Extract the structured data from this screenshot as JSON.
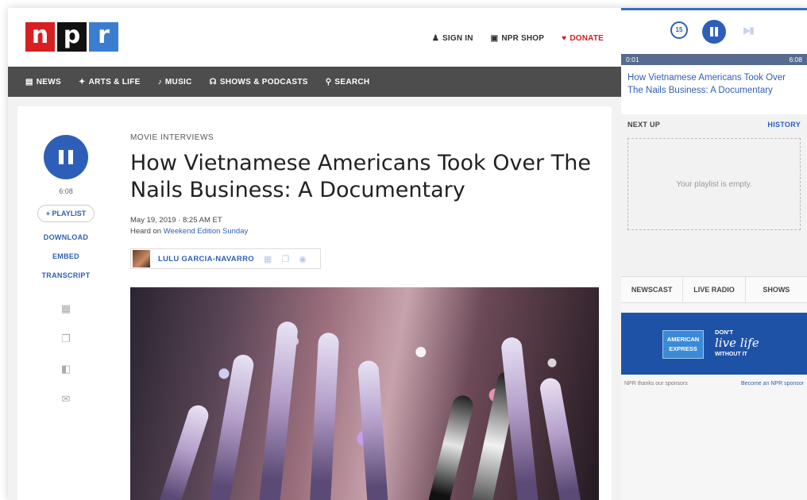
{
  "logo": {
    "letters": [
      "n",
      "p",
      "r"
    ]
  },
  "top_links": {
    "sign_in": "SIGN IN",
    "shop": "NPR SHOP",
    "donate": "DONATE"
  },
  "nav": {
    "items": [
      "NEWS",
      "ARTS & LIFE",
      "MUSIC",
      "SHOWS & PODCASTS",
      "SEARCH"
    ]
  },
  "article": {
    "kicker": "MOVIE INTERVIEWS",
    "headline": "How Vietnamese Americans Took Over The Nails Business: A Documentary",
    "date": "May 19, 2019 · 8:25 AM ET",
    "heard_on_prefix": "Heard on ",
    "program": "Weekend Edition Sunday",
    "author": "LULU GARCIA-NAVARRO"
  },
  "audio": {
    "duration": "6:08",
    "playlist_label": "+ PLAYLIST",
    "download": "DOWNLOAD",
    "embed": "EMBED",
    "transcript": "TRANSCRIPT"
  },
  "player": {
    "rewind_label": "15",
    "elapsed": "0:01",
    "total": "6:08",
    "now_playing": "How Vietnamese Americans Took Over The Nails Business: A Documentary",
    "next_up": "NEXT UP",
    "history": "HISTORY",
    "empty_playlist": "Your playlist is empty.",
    "tabs": [
      "NEWSCAST",
      "LIVE RADIO",
      "SHOWS"
    ]
  },
  "ad": {
    "brand_line1": "AMERICAN",
    "brand_line2": "EXPRESS",
    "dont": "DON'T",
    "live": "live life",
    "without": "WITHOUT IT"
  },
  "sponsor": {
    "thanks": "NPR thanks our sponsors",
    "become": "Become an NPR sponsor"
  },
  "colors": {
    "npr_red": "#d62021",
    "npr_blue": "#3b7ed1",
    "link_blue": "#2e5fb8",
    "nav_gray": "#4d4d4d"
  },
  "icons": {
    "sign_in": "user-icon",
    "shop": "bag-icon",
    "donate": "heart-icon",
    "news": "newspaper-icon",
    "arts": "dancer-icon",
    "music": "music-note-icon",
    "shows": "headphones-icon",
    "search": "search-icon"
  }
}
